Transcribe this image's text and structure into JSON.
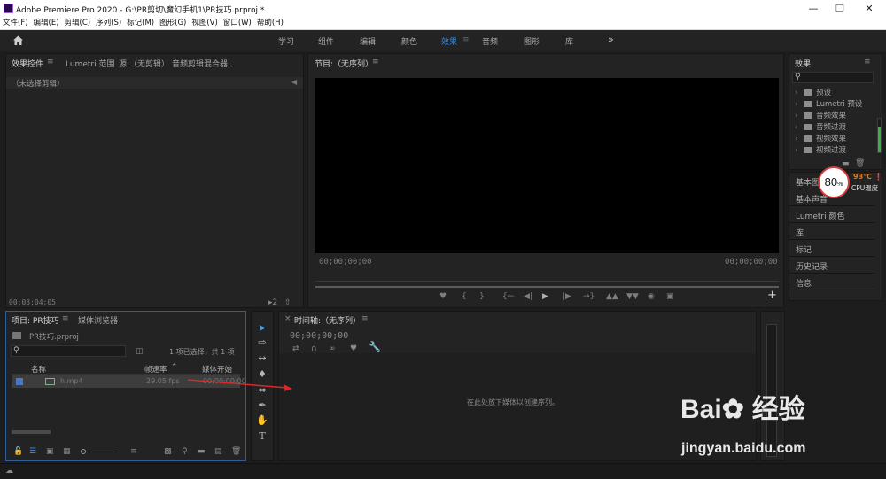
{
  "window": {
    "title": "Adobe Premiere Pro 2020 - G:\\PR剪切\\魔幻手机1\\PR技巧.prproj *",
    "minimize_icon": "minimize-icon",
    "maximize_icon": "maximize-icon",
    "close_icon": "close-icon"
  },
  "menu": [
    "文件(F)",
    "编辑(E)",
    "剪辑(C)",
    "序列(S)",
    "标记(M)",
    "图形(G)",
    "视图(V)",
    "窗口(W)",
    "帮助(H)"
  ],
  "workspaces": {
    "tabs": [
      "学习",
      "组件",
      "编辑",
      "颜色",
      "效果",
      "音频",
      "图形",
      "库"
    ],
    "active": "效果",
    "more": "»"
  },
  "effect_controls": {
    "tabs": [
      "效果控件",
      "Lumetri 范围",
      "源:（无剪辑）",
      "音频剪辑混合器:"
    ],
    "empty_text": "（未选择剪辑）",
    "timecode": "00;03;04;05"
  },
  "program_monitor": {
    "title": "节目:（无序列）",
    "timecode_left": "00;00;00;00",
    "timecode_right": "00;00;00;00"
  },
  "effects_panel": {
    "title": "效果",
    "search_placeholder": "",
    "items": [
      "预设",
      "Lumetri 预设",
      "音频效果",
      "音频过渡",
      "视频效果",
      "视频过渡"
    ],
    "side_items": [
      "基本图形",
      "基本声音",
      "Lumetri 颜色",
      "库",
      "标记",
      "历史记录",
      "信息"
    ]
  },
  "cpu": {
    "percent": "80",
    "unit": "%",
    "temp": "93℃",
    "label": "CPU温度"
  },
  "project": {
    "tabs": [
      "项目: PR技巧",
      "媒体浏览器"
    ],
    "file": "PR技巧.prproj",
    "selection": "1 项已选择，共 1 项",
    "columns": [
      "名称",
      "帧速率",
      "媒体开始"
    ],
    "rows": [
      {
        "name": "h.mp4",
        "fps": "29.05 fps",
        "start": "00;00;00;00"
      }
    ]
  },
  "timeline": {
    "title": "时间轴:（无序列）",
    "timecode": "00;00;00;00",
    "drop_text": "在此处放下媒体以创建序列。"
  },
  "watermark": {
    "brand": "Bai",
    "brand2": "经验",
    "url": "jingyan.baidu.com"
  },
  "colors": {
    "accent": "#2d8ceb",
    "panel": "#232323",
    "gauge_ring": "#d63c3c",
    "temp": "#e07a1c"
  }
}
